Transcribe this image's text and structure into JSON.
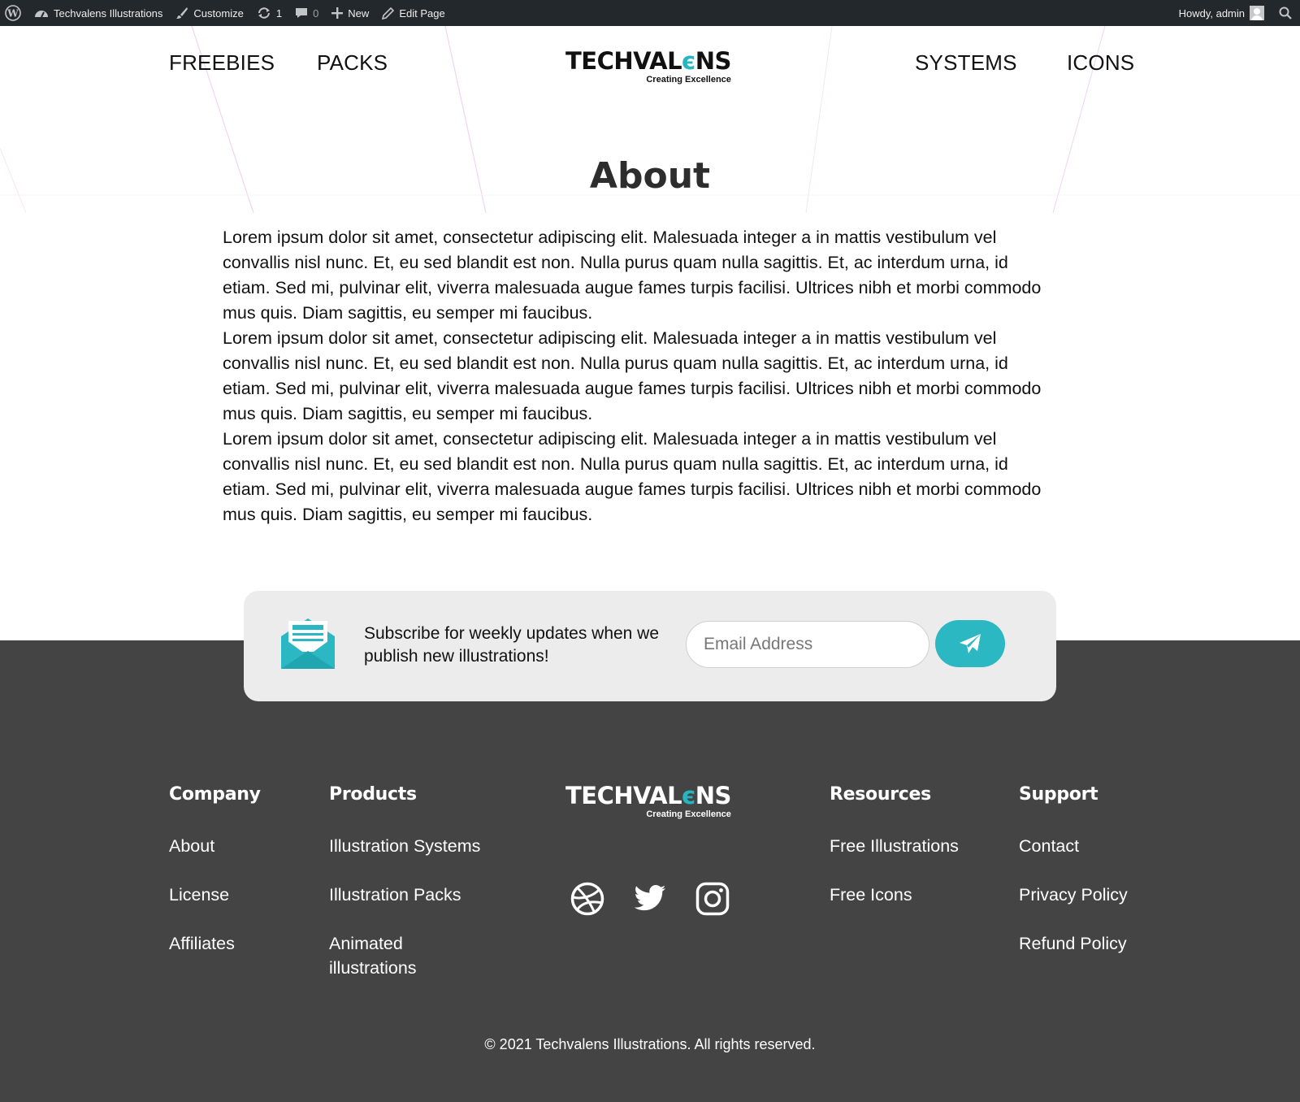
{
  "adminbar": {
    "site_name": "Techvalens Illustrations",
    "customize": "Customize",
    "updates_count": "1",
    "comments_count": "0",
    "new_label": "New",
    "edit_page": "Edit Page",
    "howdy": "Howdy, admin"
  },
  "nav": {
    "left": [
      "FREEBIES",
      "PACKS"
    ],
    "right": [
      "SYSTEMS",
      "ICONS"
    ]
  },
  "logo": {
    "word_before": "TECHVAL",
    "e_letter": "є",
    "word_after": "NS",
    "tagline": "Creating Excellence",
    "accent_color": "#26b6c2"
  },
  "page": {
    "title": "About",
    "paragraphs": [
      "Lorem ipsum dolor sit amet, consectetur adipiscing elit. Malesuada integer a in mattis vestibulum vel convallis nisl nunc. Et, eu sed blandit est non. Nulla purus quam nulla sagittis. Et, ac interdum urna, id etiam. Sed mi, pulvinar elit, viverra malesuada augue fames turpis facilisi. Ultrices nibh et morbi commodo mus quis. Diam sagittis, eu semper mi faucibus.",
      "Lorem ipsum dolor sit amet, consectetur adipiscing elit. Malesuada integer a in mattis vestibulum vel convallis nisl nunc. Et, eu sed blandit est non. Nulla purus quam nulla sagittis. Et, ac interdum urna, id etiam. Sed mi, pulvinar elit, viverra malesuada augue fames turpis facilisi. Ultrices nibh et morbi commodo mus quis. Diam sagittis, eu semper mi faucibus.",
      "Lorem ipsum dolor sit amet, consectetur adipiscing elit. Malesuada integer a in mattis vestibulum vel convallis nisl nunc. Et, eu sed blandit est non. Nulla purus quam nulla sagittis. Et, ac interdum urna, id etiam. Sed mi, pulvinar elit, viverra malesuada augue fames turpis facilisi. Ultrices nibh et morbi commodo mus quis. Diam sagittis, eu semper mi faucibus."
    ]
  },
  "subscribe": {
    "text": "Subscribe for weekly updates when we publish new illustrations!",
    "placeholder": "Email Address",
    "button_color": "#2bb8c3"
  },
  "footer": {
    "columns": {
      "company": {
        "title": "Company",
        "links": [
          "About",
          "License",
          "Affiliates"
        ]
      },
      "products": {
        "title": "Products",
        "links": [
          "Illustration Systems",
          "Illustration Packs",
          "Animated illustrations"
        ]
      },
      "resources": {
        "title": "Resources",
        "links": [
          "Free Illustrations",
          "Free Icons"
        ]
      },
      "support": {
        "title": "Support",
        "links": [
          "Contact",
          "Privacy Policy",
          "Refund Policy"
        ]
      }
    },
    "social_icons": [
      "dribbble-icon",
      "twitter-icon",
      "instagram-icon"
    ],
    "copyright": "© 2021 Techvalens Illustrations. All rights reserved.",
    "background_color": "#444444"
  }
}
